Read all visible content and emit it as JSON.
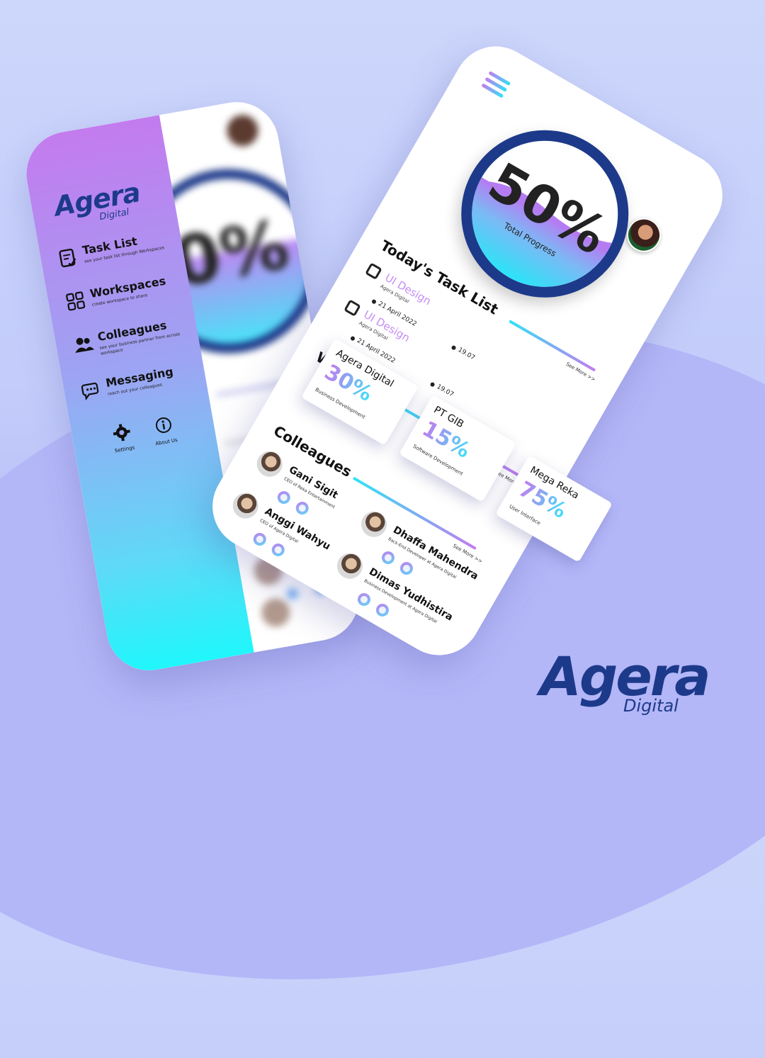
{
  "brand": {
    "name": "Agera",
    "tagline": "Digital"
  },
  "drawer": {
    "menu": [
      {
        "title": "Task List",
        "subtitle": "see your task list through Workspaces"
      },
      {
        "title": "Workspaces",
        "subtitle": "create workspace to share"
      },
      {
        "title": "Colleagues",
        "subtitle": "see your business partner from across workspace"
      },
      {
        "title": "Messaging",
        "subtitle": "reach out your colleagues"
      }
    ],
    "footer": {
      "settings": "Settings",
      "about": "About Us"
    }
  },
  "progress": {
    "value": "50%",
    "label": "Total Progress",
    "fill_fraction": 0.5
  },
  "tasks": {
    "title": "Today's Task List",
    "see_more": "See More >>",
    "items": [
      {
        "title": "UI Design",
        "company": "Agera Digital",
        "date": "21 April 2022",
        "time": "19.07"
      },
      {
        "title": "UI Design",
        "company": "Agera Digital",
        "date": "21 April 2022",
        "time": "19.07"
      }
    ]
  },
  "workspaces": {
    "title": "Workspaces",
    "see_more": "See More >>",
    "items": [
      {
        "name": "Agera Digital",
        "percent": "30%",
        "category": "Business Development"
      },
      {
        "name": "PT GIB",
        "percent": "15%",
        "category": "Software Development"
      },
      {
        "name": "Mega Reka",
        "percent": "75%",
        "category": "User Interface"
      }
    ]
  },
  "colleagues": {
    "title": "Colleagues",
    "see_more": "See More >>",
    "items": [
      {
        "name": "Gani Sigit",
        "role": "CEO of Reka Entertainment"
      },
      {
        "name": "Anggi Wahyu",
        "role": "CEO of Agera Digital"
      },
      {
        "name": "Dhaffa Mahendra",
        "role": "Back-End Developer at Agera Digital"
      },
      {
        "name": "Dimas Yudhistira",
        "role": "Business Development at Agera Digital"
      }
    ]
  },
  "colors": {
    "brand_blue": "#1d3a8a",
    "accent_purple": "#c37bee",
    "accent_cyan": "#2fe3f7"
  }
}
